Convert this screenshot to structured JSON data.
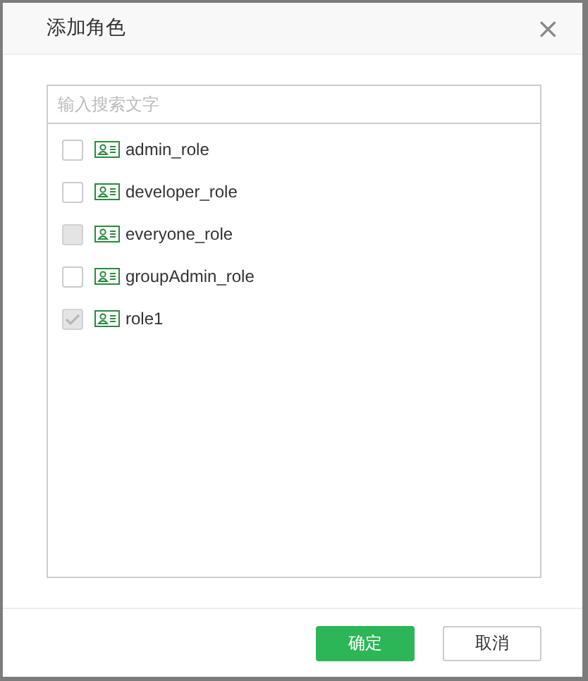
{
  "dialog": {
    "title": "添加角色",
    "close": "×"
  },
  "search": {
    "placeholder": "输入搜索文字"
  },
  "roles": [
    {
      "name": "admin_role",
      "checked": false,
      "disabled": false
    },
    {
      "name": "developer_role",
      "checked": false,
      "disabled": false
    },
    {
      "name": "everyone_role",
      "checked": false,
      "disabled": true
    },
    {
      "name": "groupAdmin_role",
      "checked": false,
      "disabled": false
    },
    {
      "name": "role1",
      "checked": true,
      "disabled": true
    }
  ],
  "buttons": [
    {
      "label": "确定",
      "kind": "primary"
    },
    {
      "label": "取消",
      "kind": "default"
    }
  ]
}
